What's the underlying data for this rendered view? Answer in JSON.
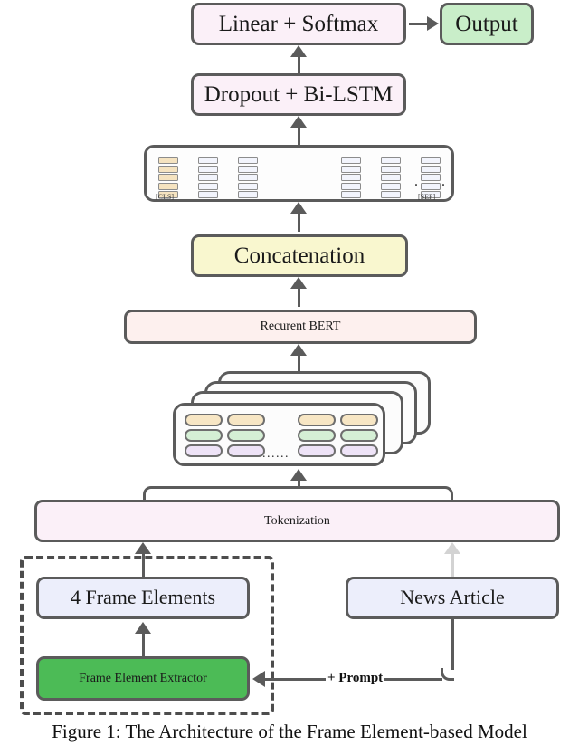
{
  "figure": {
    "caption": "Figure 1: The Architecture of the Frame Element-based Model"
  },
  "nodes": {
    "linear_softmax": "Linear + Softmax",
    "output": "Output",
    "dropout_bilstm": "Dropout + Bi-LSTM",
    "concatenation": "Concatenation",
    "recurrent_bert": "Recurent BERT",
    "tokenization": "Tokenization",
    "frame_elements": "4 Frame Elements",
    "news_article": "News Article",
    "frame_element_extractor": "Frame Element Extractor"
  },
  "labels": {
    "cls_token": "[CLS]",
    "sep_token": "[SEP]",
    "prompt": "+ Prompt",
    "embedding_ellipsis": "......",
    "card_ellipsis": "......",
    "flow_ellipsis": "......"
  },
  "colors": {
    "box_pink": "#fbf0f8",
    "box_green": "#c9eec9",
    "box_yellow": "#f9f7cf",
    "box_rose": "#fdf0ee",
    "box_blue": "#eceefb",
    "extractor_green": "#4cbb56",
    "border": "#5b5b5b",
    "faint_arrow": "#d3d3d3",
    "token_tan": "#f5e3c0",
    "token_blue": "#f2f4fc",
    "pill_tan": "#f7e6c4",
    "pill_green": "#d5efd5",
    "pill_purple": "#eee3f7"
  },
  "structure": {
    "embedding_columns": 6,
    "embedding_cells_per_column": 5,
    "card_layers": 4,
    "card_pill_columns": 4,
    "card_pill_rows": 3
  }
}
